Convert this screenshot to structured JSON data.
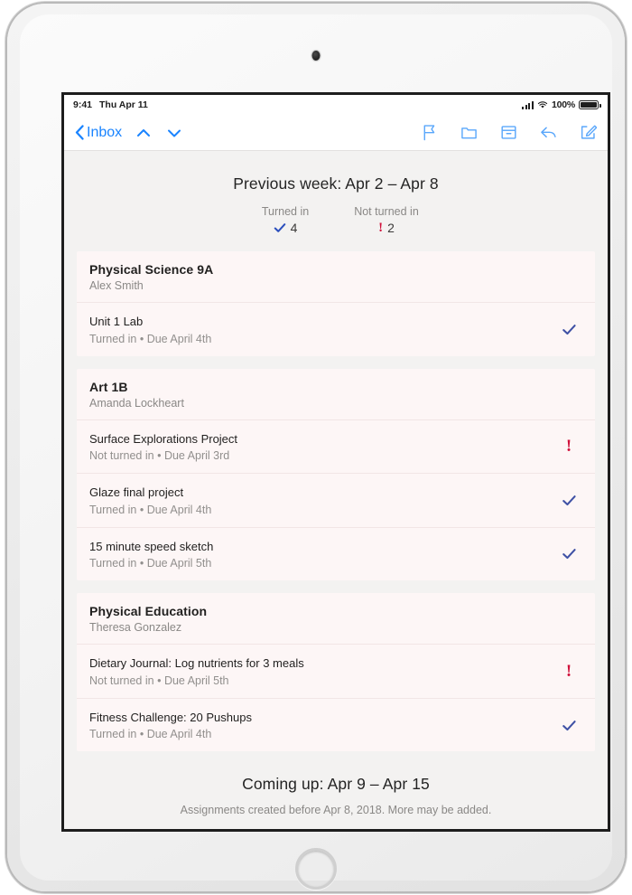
{
  "status_bar": {
    "time": "9:41",
    "date": "Thu Apr 11",
    "battery_percent": "100%",
    "cellular_icon": "cellular-signal-icon",
    "wifi_icon": "wifi-icon",
    "battery_icon": "battery-icon"
  },
  "nav": {
    "back_label": "Inbox",
    "back_icon": "chevron-left-icon",
    "prev_message_icon": "chevron-up-icon",
    "next_message_icon": "chevron-down-icon",
    "flag_icon": "flag-icon",
    "folder_icon": "folder-icon",
    "archive_icon": "archive-icon",
    "reply_icon": "reply-icon",
    "compose_icon": "compose-icon"
  },
  "colors": {
    "ios_blue": "#1a84ff",
    "check_blue": "#3f51a5",
    "stat_check_blue": "#2b4fbd",
    "alert_red": "#d0103a",
    "card_background": "#fdf6f6",
    "page_background": "#f3f2f1"
  },
  "week": {
    "title": "Previous week: Apr 2 – Apr 8",
    "stats": [
      {
        "label": "Turned in",
        "value": "4",
        "icon": "checkmark-icon"
      },
      {
        "label": "Not turned in",
        "value": "2",
        "icon": "exclamation-icon"
      }
    ]
  },
  "classes": [
    {
      "name": "Physical Science 9A",
      "teacher": "Alex Smith",
      "assignments": [
        {
          "title": "Unit 1 Lab",
          "status": "Turned in",
          "separator": "•",
          "due": "Due April 4th",
          "state": "turned-in",
          "icon": "checkmark-icon"
        }
      ]
    },
    {
      "name": "Art 1B",
      "teacher": "Amanda Lockheart",
      "assignments": [
        {
          "title": "Surface Explorations Project",
          "status": "Not turned in",
          "separator": "•",
          "due": "Due April 3rd",
          "state": "not-turned-in",
          "icon": "exclamation-icon"
        },
        {
          "title": "Glaze final project",
          "status": "Turned in",
          "separator": "•",
          "due": "Due April 4th",
          "state": "turned-in",
          "icon": "checkmark-icon"
        },
        {
          "title": "15 minute speed sketch",
          "status": "Turned in",
          "separator": "•",
          "due": "Due April 5th",
          "state": "turned-in",
          "icon": "checkmark-icon"
        }
      ]
    },
    {
      "name": "Physical Education",
      "teacher": "Theresa Gonzalez",
      "assignments": [
        {
          "title": "Dietary Journal: Log nutrients for 3 meals",
          "status": "Not turned in",
          "separator": "•",
          "due": "Due April 5th",
          "state": "not-turned-in",
          "icon": "exclamation-icon"
        },
        {
          "title": "Fitness Challenge: 20 Pushups",
          "status": "Turned in",
          "separator": "•",
          "due": "Due April 4th",
          "state": "turned-in",
          "icon": "checkmark-icon"
        }
      ]
    }
  ],
  "coming_up": {
    "title": "Coming up: Apr 9 – Apr 15",
    "note": "Assignments created before Apr 8, 2018. More may be added."
  }
}
